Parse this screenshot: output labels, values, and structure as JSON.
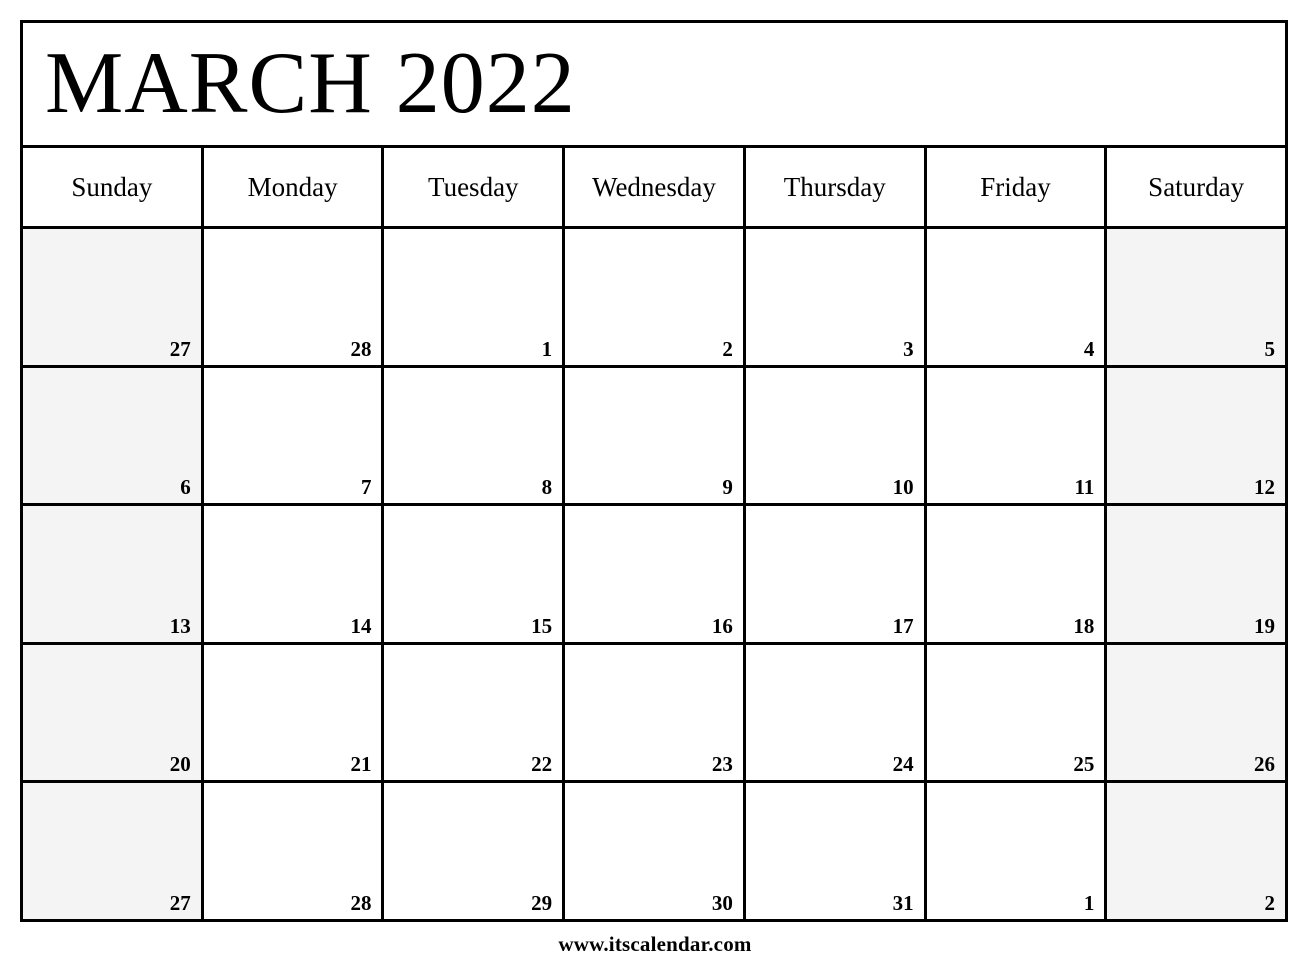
{
  "calendar": {
    "title": "MARCH 2022",
    "month": "MARCH",
    "year": "2022",
    "weekday_headers": [
      {
        "label": "Sunday",
        "weekend": true
      },
      {
        "label": "Monday",
        "weekend": false
      },
      {
        "label": "Tuesday",
        "weekend": false
      },
      {
        "label": "Wednesday",
        "weekend": false
      },
      {
        "label": "Thursday",
        "weekend": false
      },
      {
        "label": "Friday",
        "weekend": false
      },
      {
        "label": "Saturday",
        "weekend": true
      }
    ],
    "weeks": [
      [
        {
          "day": "27",
          "weekend": true,
          "other_month": true
        },
        {
          "day": "28",
          "weekend": false,
          "other_month": true
        },
        {
          "day": "1",
          "weekend": false,
          "other_month": false
        },
        {
          "day": "2",
          "weekend": false,
          "other_month": false
        },
        {
          "day": "3",
          "weekend": false,
          "other_month": false
        },
        {
          "day": "4",
          "weekend": false,
          "other_month": false
        },
        {
          "day": "5",
          "weekend": true,
          "other_month": false
        }
      ],
      [
        {
          "day": "6",
          "weekend": true,
          "other_month": false
        },
        {
          "day": "7",
          "weekend": false,
          "other_month": false
        },
        {
          "day": "8",
          "weekend": false,
          "other_month": false
        },
        {
          "day": "9",
          "weekend": false,
          "other_month": false
        },
        {
          "day": "10",
          "weekend": false,
          "other_month": false
        },
        {
          "day": "11",
          "weekend": false,
          "other_month": false
        },
        {
          "day": "12",
          "weekend": true,
          "other_month": false
        }
      ],
      [
        {
          "day": "13",
          "weekend": true,
          "other_month": false
        },
        {
          "day": "14",
          "weekend": false,
          "other_month": false
        },
        {
          "day": "15",
          "weekend": false,
          "other_month": false
        },
        {
          "day": "16",
          "weekend": false,
          "other_month": false
        },
        {
          "day": "17",
          "weekend": false,
          "other_month": false
        },
        {
          "day": "18",
          "weekend": false,
          "other_month": false
        },
        {
          "day": "19",
          "weekend": true,
          "other_month": false
        }
      ],
      [
        {
          "day": "20",
          "weekend": true,
          "other_month": false
        },
        {
          "day": "21",
          "weekend": false,
          "other_month": false
        },
        {
          "day": "22",
          "weekend": false,
          "other_month": false
        },
        {
          "day": "23",
          "weekend": false,
          "other_month": false
        },
        {
          "day": "24",
          "weekend": false,
          "other_month": false
        },
        {
          "day": "25",
          "weekend": false,
          "other_month": false
        },
        {
          "day": "26",
          "weekend": true,
          "other_month": false
        }
      ],
      [
        {
          "day": "27",
          "weekend": true,
          "other_month": false
        },
        {
          "day": "28",
          "weekend": false,
          "other_month": false
        },
        {
          "day": "29",
          "weekend": false,
          "other_month": false
        },
        {
          "day": "30",
          "weekend": false,
          "other_month": false
        },
        {
          "day": "31",
          "weekend": false,
          "other_month": false
        },
        {
          "day": "1",
          "weekend": false,
          "other_month": true
        },
        {
          "day": "2",
          "weekend": true,
          "other_month": true
        }
      ]
    ]
  },
  "footer": {
    "website": "www.itscalendar.com"
  },
  "colors": {
    "border": "#000000",
    "text": "#000000",
    "page_background": "#ffffff",
    "cell_background": "#ffffff",
    "weekend_background": "#f4f4f4"
  }
}
